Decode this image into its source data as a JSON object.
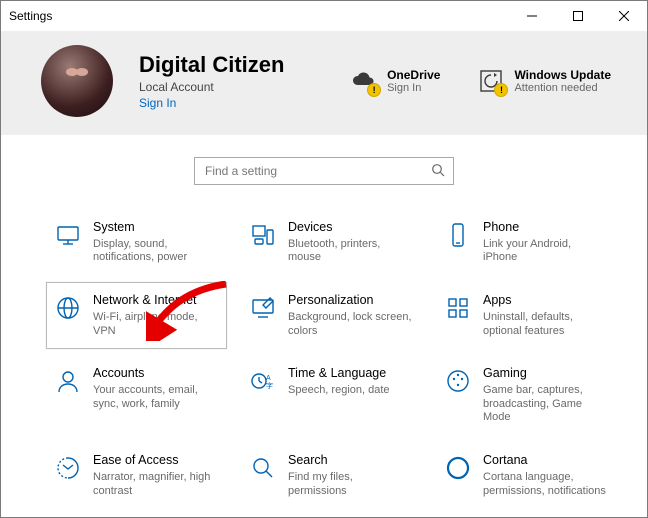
{
  "window": {
    "title": "Settings"
  },
  "user": {
    "name": "Digital Citizen",
    "account_type": "Local Account",
    "signin_link": "Sign In"
  },
  "header_shortcuts": {
    "onedrive": {
      "title": "OneDrive",
      "sub": "Sign In"
    },
    "update": {
      "title": "Windows Update",
      "sub": "Attention needed"
    }
  },
  "search": {
    "placeholder": "Find a setting"
  },
  "categories": [
    {
      "id": "system",
      "title": "System",
      "sub": "Display, sound, notifications, power"
    },
    {
      "id": "devices",
      "title": "Devices",
      "sub": "Bluetooth, printers, mouse"
    },
    {
      "id": "phone",
      "title": "Phone",
      "sub": "Link your Android, iPhone"
    },
    {
      "id": "network",
      "title": "Network & Internet",
      "sub": "Wi-Fi, airplane mode, VPN",
      "selected": true
    },
    {
      "id": "personalize",
      "title": "Personalization",
      "sub": "Background, lock screen, colors"
    },
    {
      "id": "apps",
      "title": "Apps",
      "sub": "Uninstall, defaults, optional features"
    },
    {
      "id": "accounts",
      "title": "Accounts",
      "sub": "Your accounts, email, sync, work, family"
    },
    {
      "id": "time",
      "title": "Time & Language",
      "sub": "Speech, region, date"
    },
    {
      "id": "gaming",
      "title": "Gaming",
      "sub": "Game bar, captures, broadcasting, Game Mode"
    },
    {
      "id": "ease",
      "title": "Ease of Access",
      "sub": "Narrator, magnifier, high contrast"
    },
    {
      "id": "search",
      "title": "Search",
      "sub": "Find my files, permissions"
    },
    {
      "id": "cortana",
      "title": "Cortana",
      "sub": "Cortana language, permissions, notifications"
    }
  ]
}
